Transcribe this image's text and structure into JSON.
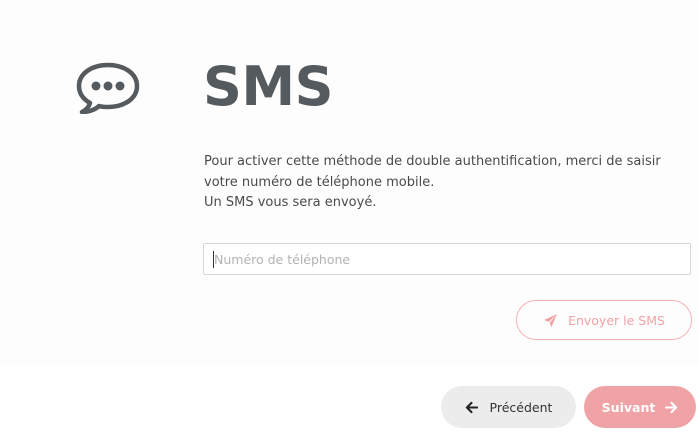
{
  "header": {
    "icon": "chat-bubble-dots-icon",
    "title": "SMS"
  },
  "description": {
    "line1": "Pour activer cette méthode de double authentification, merci de saisir votre numéro de téléphone mobile.",
    "line2": "Un SMS vous sera envoyé."
  },
  "phone": {
    "placeholder": "Numéro de téléphone",
    "value": ""
  },
  "send_button": {
    "label": "Envoyer le SMS",
    "icon": "paper-plane-icon"
  },
  "footer": {
    "previous_label": "Précédent",
    "previous_icon": "arrow-left-icon",
    "next_label": "Suivant",
    "next_icon": "arrow-right-icon"
  },
  "colors": {
    "title": "#555a5e",
    "accent": "#f0a3a6",
    "secondary_button": "#ececec"
  }
}
